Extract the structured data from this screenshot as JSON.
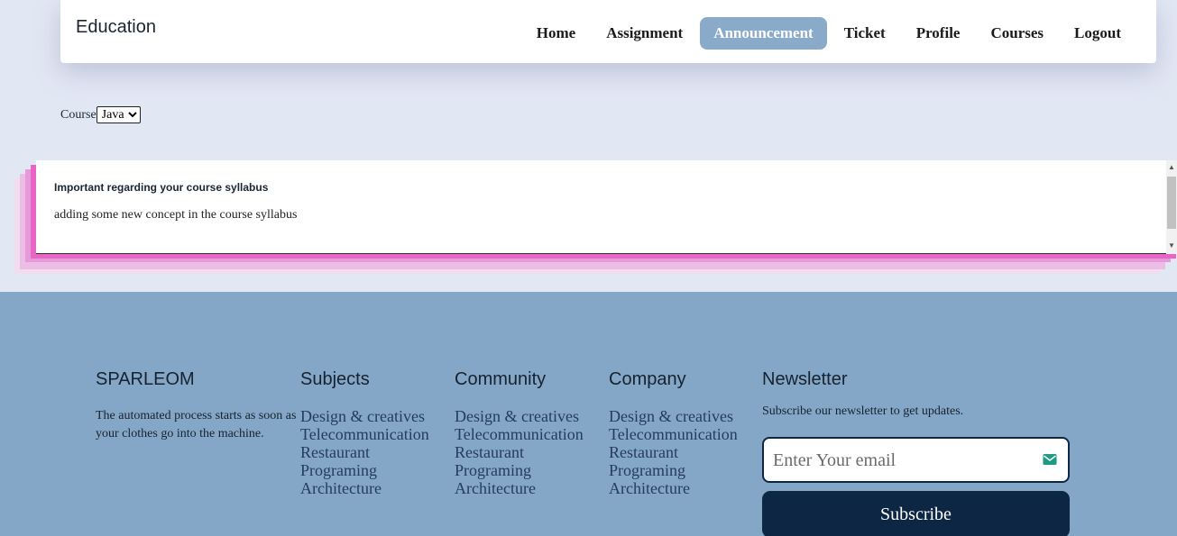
{
  "navbar": {
    "brand": "Education",
    "links": [
      {
        "label": "Home",
        "active": false
      },
      {
        "label": "Assignment",
        "active": false
      },
      {
        "label": "Announcement",
        "active": true
      },
      {
        "label": "Ticket",
        "active": false
      },
      {
        "label": "Profile",
        "active": false
      },
      {
        "label": "Courses",
        "active": false
      },
      {
        "label": "Logout",
        "active": false
      }
    ]
  },
  "course_filter": {
    "label": "Course",
    "selected": "Java"
  },
  "announcement": {
    "title": "Important regarding your course syllabus",
    "body": "adding some new concept in the course syllabus"
  },
  "footer": {
    "brand": {
      "title": "SPARLEOM",
      "text": "The automated process starts as soon as your clothes go into the machine."
    },
    "subjects": {
      "title": "Subjects",
      "links": [
        "Design & creatives",
        "Telecommunication",
        "Restaurant",
        "Programing",
        "Architecture"
      ]
    },
    "community": {
      "title": "Community",
      "links": [
        "Design & creatives",
        "Telecommunication",
        "Restaurant",
        "Programing",
        "Architecture"
      ]
    },
    "company": {
      "title": "Company",
      "links": [
        "Design & creatives",
        "Telecommunication",
        "Restaurant",
        "Programing",
        "Architecture"
      ]
    },
    "newsletter": {
      "title": "Newsletter",
      "text": "Subscribe our newsletter to get updates.",
      "email_placeholder": "Enter Your email",
      "subscribe_label": "Subscribe",
      "icon": "mail-icon"
    }
  },
  "colors": {
    "page_bg": "#e2e7f4",
    "active_nav": "#8aaac9",
    "footer_bg": "#85a7c7",
    "button_bg": "#0c2644",
    "card_shadow_pink": "#e765c4"
  }
}
